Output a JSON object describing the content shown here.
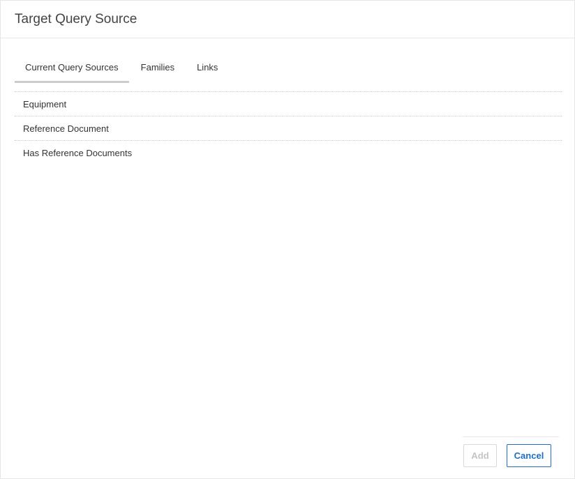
{
  "dialog": {
    "title": "Target Query Source"
  },
  "tabs": [
    {
      "label": "Current Query Sources",
      "active": true
    },
    {
      "label": "Families",
      "active": false
    },
    {
      "label": "Links",
      "active": false
    }
  ],
  "query_sources": [
    {
      "label": "Equipment"
    },
    {
      "label": "Reference Document"
    },
    {
      "label": "Has Reference Documents"
    }
  ],
  "footer": {
    "add_label": "Add",
    "add_disabled": true,
    "cancel_label": "Cancel"
  },
  "colors": {
    "accent": "#1f6ec4",
    "disabled_text": "#c4c4c4",
    "active_tab_underline": "#cccccc"
  }
}
